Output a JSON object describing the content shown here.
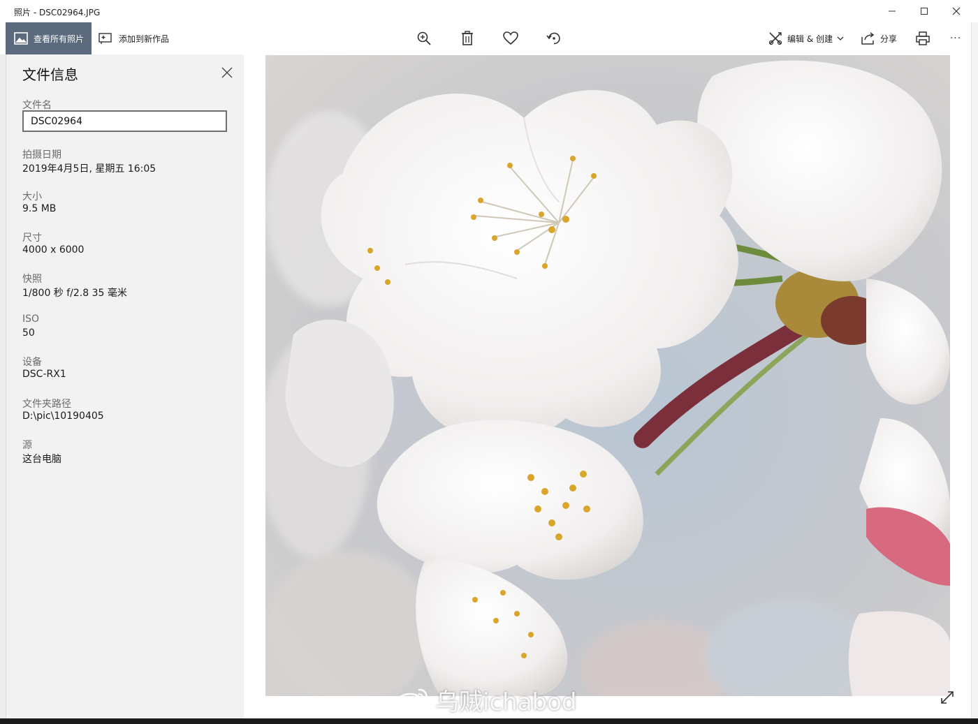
{
  "window": {
    "title": "照片 - DSC02964.JPG"
  },
  "toolbar": {
    "view_all_label": "查看所有照片",
    "add_to_label": "添加到新作品",
    "edit_create_label": "编辑 & 创建",
    "share_label": "分享",
    "more_label": "···"
  },
  "panel": {
    "title": "文件信息",
    "fields": [
      {
        "label": "文件名",
        "value": "DSC02964"
      },
      {
        "label": "拍摄日期",
        "value": "2019年4月5日, 星期五 16:05"
      },
      {
        "label": "大小",
        "value": "9.5 MB"
      },
      {
        "label": "尺寸",
        "value": "4000 x 6000"
      },
      {
        "label": "快照",
        "value": "1/800 秒 f/2.8 35 毫米"
      },
      {
        "label": "ISO",
        "value": "50"
      },
      {
        "label": "设备",
        "value": "DSC-RX1"
      },
      {
        "label": "文件夹路径",
        "value": "D:\\pic\\10190405"
      },
      {
        "label": "源",
        "value": "这台电脑"
      }
    ]
  },
  "watermark": {
    "text": "乌贼ichabod"
  },
  "colors": {
    "accent": "#5b6b7d",
    "panel_bg": "#f2f2f2"
  }
}
